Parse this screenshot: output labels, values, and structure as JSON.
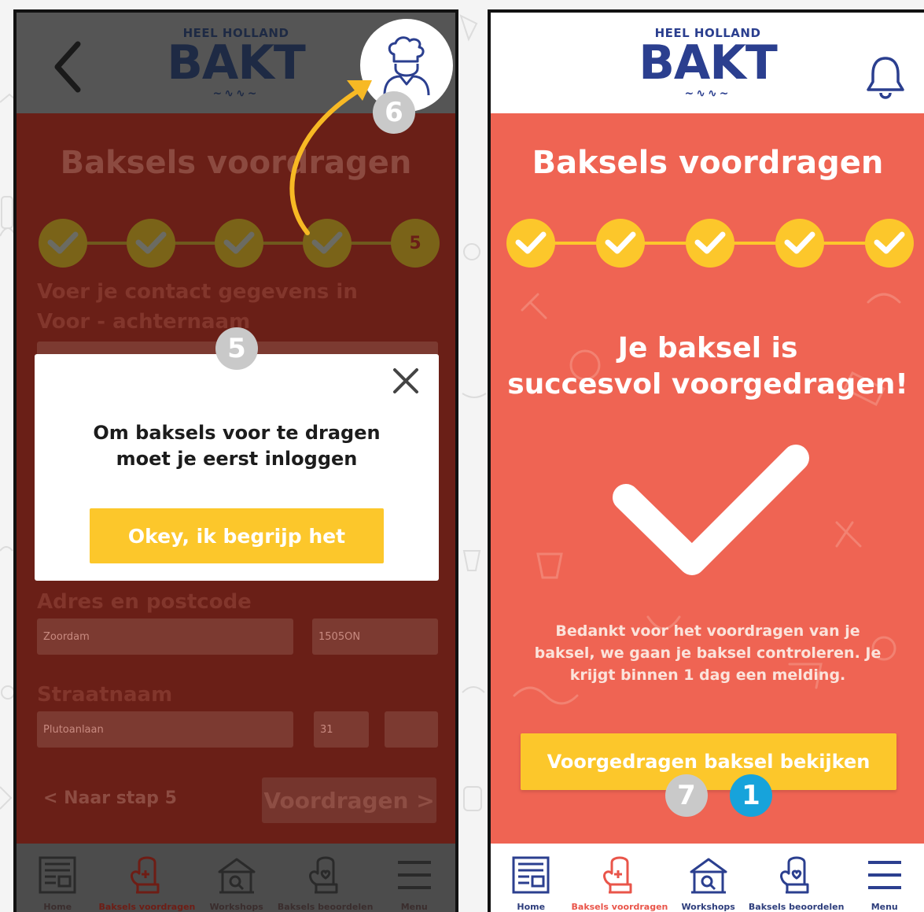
{
  "colors": {
    "coral": "#ef6453",
    "yellow": "#fcc72b",
    "navy": "#2b3f8f",
    "dim_overlay": "#6a1f17",
    "annotation_blue": "#17a3db",
    "annotation_grey": "#c9c9c9"
  },
  "brand": {
    "logo_top": "HEEL HOLLAND",
    "logo_main": "BAKT"
  },
  "left_screen": {
    "title": "Baksels voordragen",
    "current_step": "5",
    "contact_label": "Voer je contact gegevens in",
    "name_label": "Voor - achternaam",
    "address_label": "Adres en postcode",
    "city_value": "Zoordam",
    "postcode_value": "1505ON",
    "street_label": "Straatnaam",
    "street_value": "Plutoanlaan",
    "house_number": "31",
    "back_link": "< Naar stap 5",
    "submit_button": "Voordragen >",
    "modal": {
      "message_line1": "Om baksels voor te dragen",
      "message_line2": "moet je eerst inloggen",
      "ok_button": "Okey, ik begrijp het"
    }
  },
  "right_screen": {
    "title": "Baksels voordragen",
    "success_line1": "Je baksel is",
    "success_line2": "succesvol voorgedragen!",
    "thanks_line1": "Bedankt voor het voordragen van je",
    "thanks_line2": "baksel, we gaan je baksel controleren. Je",
    "thanks_line3": "krijgt binnen 1 dag een melding.",
    "view_button": "Voorgedragen baksel bekijken"
  },
  "tabbar": {
    "home": "Home",
    "submit": "Baksels voordragen",
    "workshops": "Workshops",
    "rate": "Baksels beoordelen",
    "menu": "Menu"
  },
  "annotations": {
    "badge_5": "5",
    "badge_6": "6",
    "badge_7": "7",
    "badge_1": "1"
  },
  "icons": [
    "back-arrow-icon",
    "chef-icon",
    "bell-icon",
    "close-icon",
    "check-icon",
    "newspaper-icon",
    "oven-mitt-plus-icon",
    "tent-icon",
    "oven-mitt-heart-icon",
    "hamburger-icon"
  ]
}
